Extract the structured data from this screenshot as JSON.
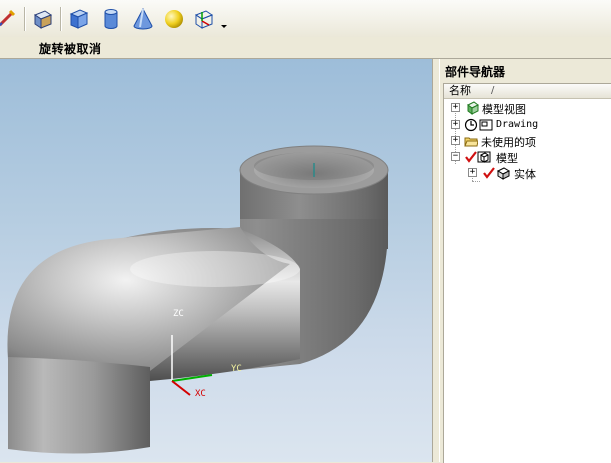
{
  "status": {
    "message": "旋转被取消"
  },
  "toolbar": {
    "buttons": [
      {
        "icon": "sketch-pen-icon"
      },
      {
        "icon": "block-view-icon"
      },
      {
        "icon": "cube-icon"
      },
      {
        "icon": "cylinder-icon"
      },
      {
        "icon": "cone-icon"
      },
      {
        "icon": "sphere-icon"
      },
      {
        "icon": "coordinate-system-icon"
      },
      {
        "icon": "dropdown-arrow-icon"
      }
    ]
  },
  "viewport": {
    "axes": {
      "zc": "ZC",
      "yc": "YC",
      "xc": "XC"
    },
    "colors": {
      "x_axis": "#d40000",
      "y_axis": "#00b000",
      "z_axis": "#ffffff",
      "model_gray": "#a9a9a9"
    }
  },
  "navigator": {
    "title": "部件导航器",
    "column_name": "名称",
    "column_sort": "/",
    "items": [
      {
        "label": "模型视图",
        "icon": "model-views-icon",
        "expander": "+",
        "level": 0,
        "checked": false
      },
      {
        "label": "Drawing",
        "icon": "drawing-clock-icon",
        "expander": "+",
        "level": 0,
        "checked": false
      },
      {
        "label": "未使用的项",
        "icon": "folder-icon",
        "expander": "+",
        "level": 0,
        "checked": false
      },
      {
        "label": "模型",
        "icon": "model-icon",
        "expander": "−",
        "level": 0,
        "checked": true
      },
      {
        "label": "实体",
        "icon": "solid-body-icon",
        "expander": "+",
        "level": 1,
        "checked": true
      }
    ]
  }
}
